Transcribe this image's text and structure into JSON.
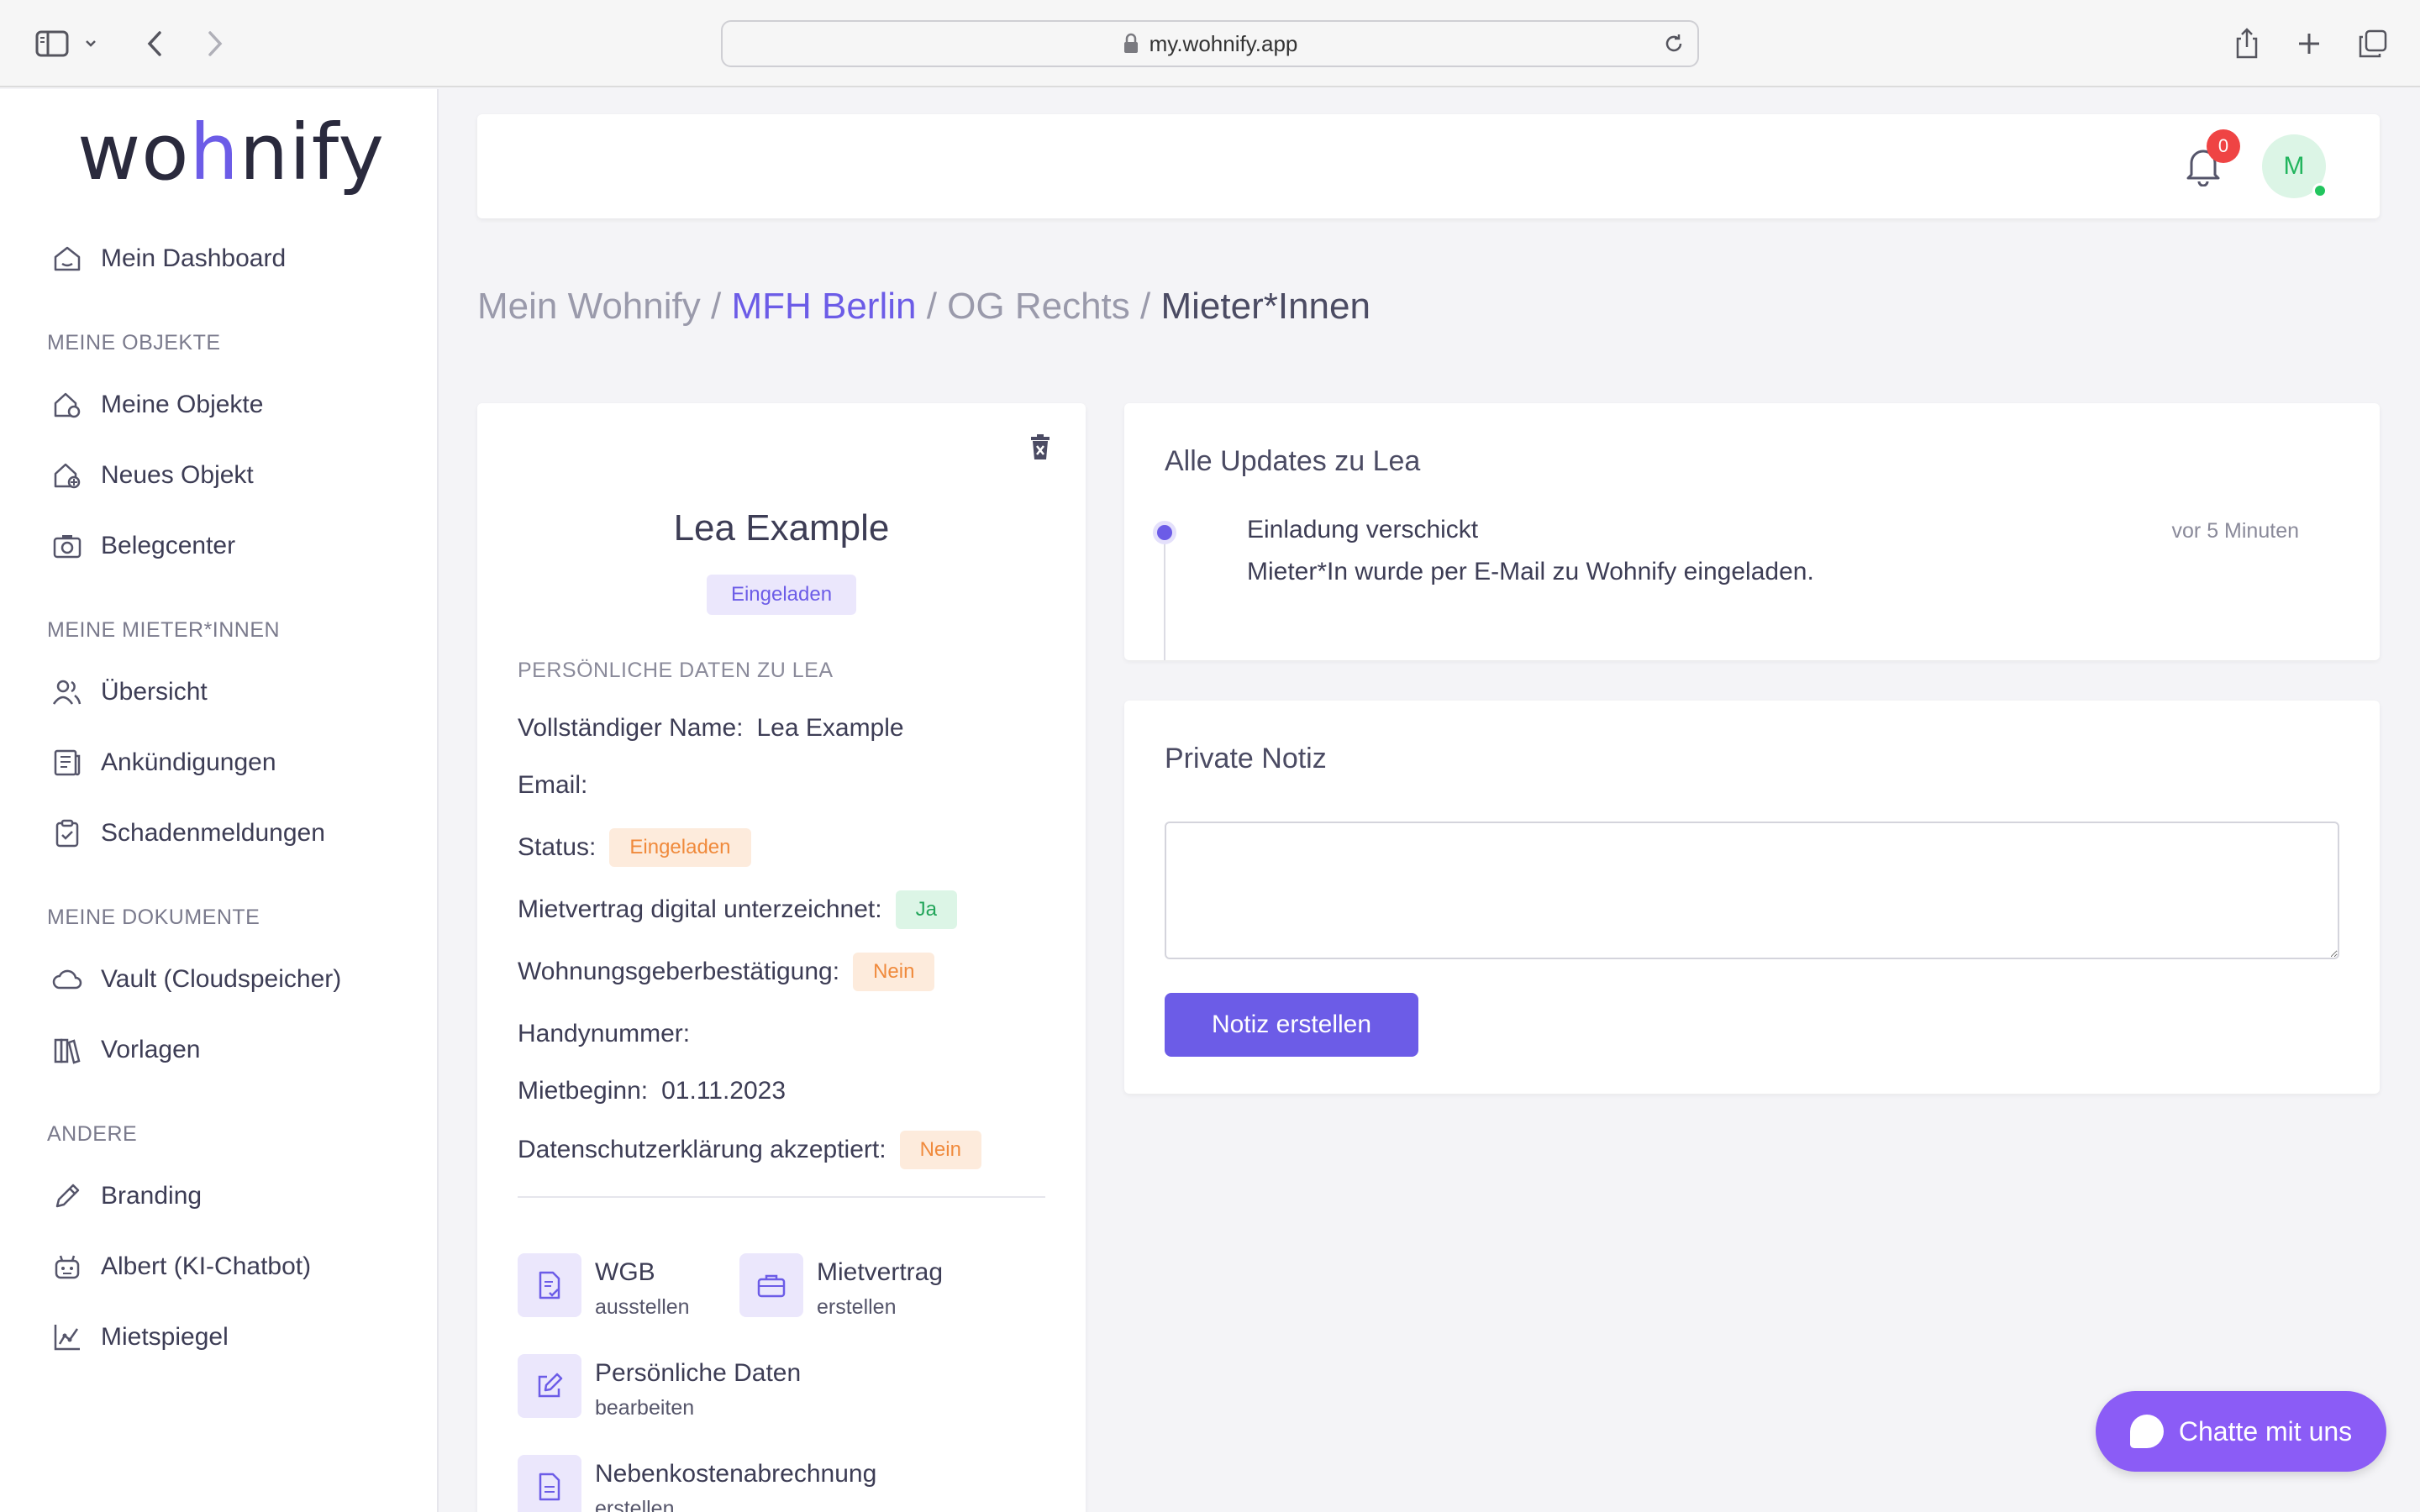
{
  "browser": {
    "url": "my.wohnify.app"
  },
  "logo": {
    "part1": "wo",
    "part2": "h",
    "part3": "nify"
  },
  "sidebar": {
    "dashboard": "Mein Dashboard",
    "section_objects": "MEINE OBJEKTE",
    "objects": [
      "Meine Objekte",
      "Neues Objekt",
      "Belegcenter"
    ],
    "section_tenants": "MEINE MIETER*INNEN",
    "tenants": [
      "Übersicht",
      "Ankündigungen",
      "Schadenmeldungen"
    ],
    "section_docs": "MEINE DOKUMENTE",
    "docs": [
      "Vault (Cloudspeicher)",
      "Vorlagen"
    ],
    "section_other": "ANDERE",
    "other": [
      "Branding",
      "Albert (KI-Chatbot)",
      "Mietspiegel"
    ]
  },
  "header": {
    "notification_count": "0",
    "avatar_initial": "M"
  },
  "breadcrumb": {
    "root": "Mein Wohnify",
    "property": "MFH Berlin",
    "unit": "OG Rechts",
    "current": "Mieter*Innen",
    "separator": " / "
  },
  "tenant": {
    "name": "Lea Example",
    "status_badge": "Eingeladen",
    "section_label": "PERSÖNLICHE DATEN ZU LEA",
    "fields": {
      "full_name_label": "Vollständiger Name:",
      "full_name_value": "Lea Example",
      "email_label": "Email:",
      "email_value": "",
      "status_label": "Status:",
      "status_value": "Eingeladen",
      "contract_label": "Mietvertrag digital unterzeichnet:",
      "contract_value": "Ja",
      "landlord_label": "Wohnungsgeberbestätigung:",
      "landlord_value": "Nein",
      "phone_label": "Handynummer:",
      "phone_value": "",
      "start_label": "Mietbeginn:",
      "start_value": "01.11.2023",
      "privacy_label": "Datenschutzerklärung akzeptiert:",
      "privacy_value": "Nein"
    },
    "actions": [
      {
        "title": "WGB",
        "sub": "ausstellen",
        "icon": "document-check-icon"
      },
      {
        "title": "Mietvertrag",
        "sub": "erstellen",
        "icon": "briefcase-icon"
      },
      {
        "title": "Persönliche Daten",
        "sub": "bearbeiten",
        "icon": "pencil-square-icon"
      },
      {
        "title": "Nebenkostenabrechnung",
        "sub": "erstellen",
        "icon": "document-text-icon"
      }
    ]
  },
  "updates": {
    "title": "Alle Updates zu Lea",
    "items": [
      {
        "title": "Einladung verschickt",
        "description": "Mieter*In wurde per E-Mail zu Wohnify eingeladen.",
        "time": "vor 5 Minuten"
      }
    ]
  },
  "note": {
    "title": "Private Notiz",
    "value": "",
    "button": "Notiz erstellen"
  },
  "chat": {
    "label": "Chatte mit uns"
  },
  "colors": {
    "accent": "#6c5ce7",
    "badge_red": "#ef4444",
    "chat_purple": "#8b5cf6",
    "green": "#22c55e",
    "orange": "#f08a3c"
  }
}
